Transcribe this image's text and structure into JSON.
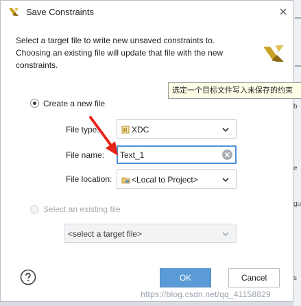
{
  "window": {
    "title": "Save Constraints"
  },
  "description": "Select a target file to write new unsaved constraints to. Choosing an existing file will update that file with the new constraints.",
  "tooltip": "选定一个目标文件写入未保存的约束",
  "create_new": {
    "label": "Create a new file",
    "selected": true,
    "file_type": {
      "label": "File type:",
      "value": "XDC"
    },
    "file_name": {
      "label": "File name:",
      "value": "Text_1"
    },
    "file_location": {
      "label": "File location:",
      "value": "<Local to Project>"
    }
  },
  "select_existing": {
    "label": "Select an existing file",
    "selected": false,
    "dropdown_value": "<select a target file>"
  },
  "buttons": {
    "ok": "OK",
    "cancel": "Cancel"
  },
  "watermark": "https://blog.csdn.net/qq_41158829",
  "background_app": {
    "fragments": [
      "b",
      "e",
      "gu",
      "s"
    ]
  },
  "colors": {
    "primary_button": "#5b9bd5",
    "focus_border": "#4a90d9",
    "annotation_arrow": "#e8231a"
  }
}
